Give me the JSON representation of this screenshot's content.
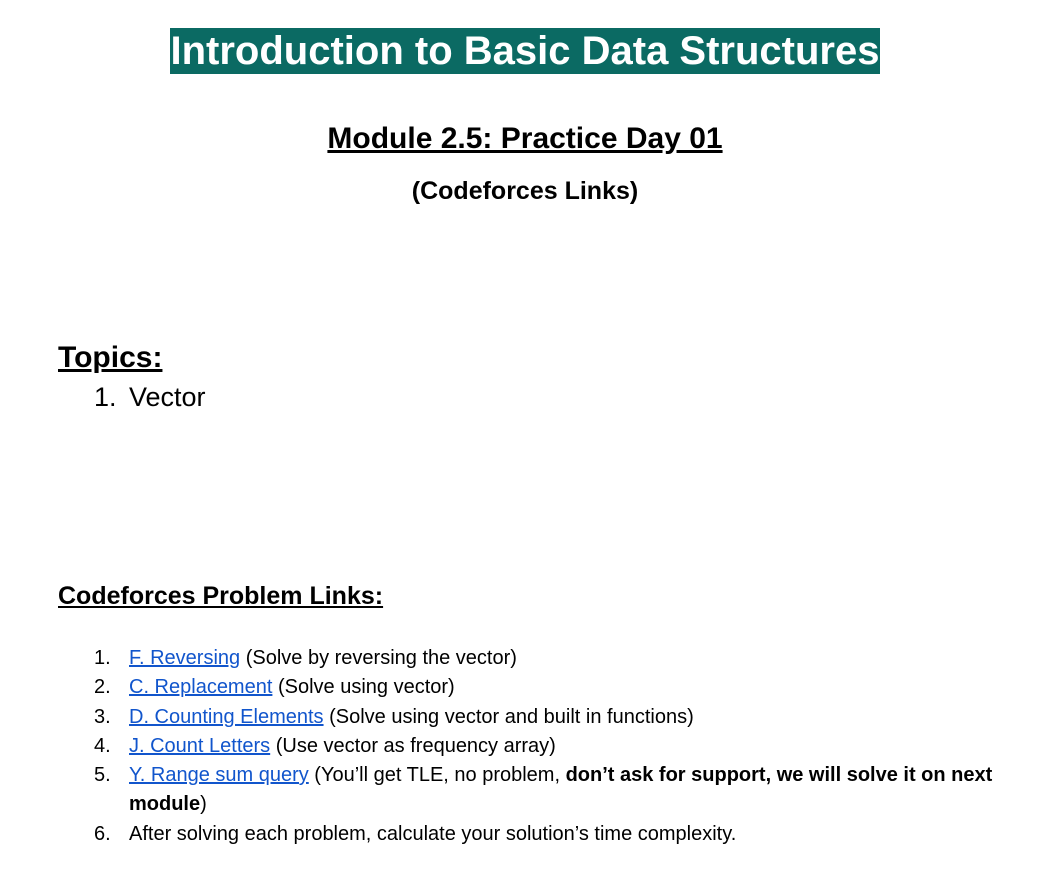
{
  "header": {
    "title": "Introduction to Basic Data Structures",
    "module_title": "Module 2.5: Practice Day 01",
    "module_subtitle": "(Codeforces Links)"
  },
  "topics": {
    "heading": "Topics:",
    "items": [
      {
        "num": "1.",
        "label": "Vector"
      }
    ]
  },
  "problems": {
    "heading": "Codeforces Problem Links:",
    "items": [
      {
        "num": "1.",
        "link": "F. Reversing",
        "note": " (Solve by reversing the vector)"
      },
      {
        "num": "2.",
        "link": "C. Replacement",
        "note": " (Solve using vector)"
      },
      {
        "num": "3.",
        "link": "D. Counting Elements",
        "note": " (Solve using vector and built in functions)"
      },
      {
        "num": "4.",
        "link": "J. Count Letters",
        "note": " (Use vector as frequency array)"
      },
      {
        "num": "5.",
        "link": "Y. Range sum query",
        "note": " (You’ll get TLE, no problem, ",
        "bold_note": "don’t ask for support, we will solve it on next module",
        "note_end": ")"
      },
      {
        "num": "6.",
        "text": "After solving each problem, calculate your solution’s time complexity."
      }
    ]
  },
  "colors": {
    "title_background": "#0b6a63",
    "title_text": "#ffffff",
    "link": "#1155cc"
  }
}
